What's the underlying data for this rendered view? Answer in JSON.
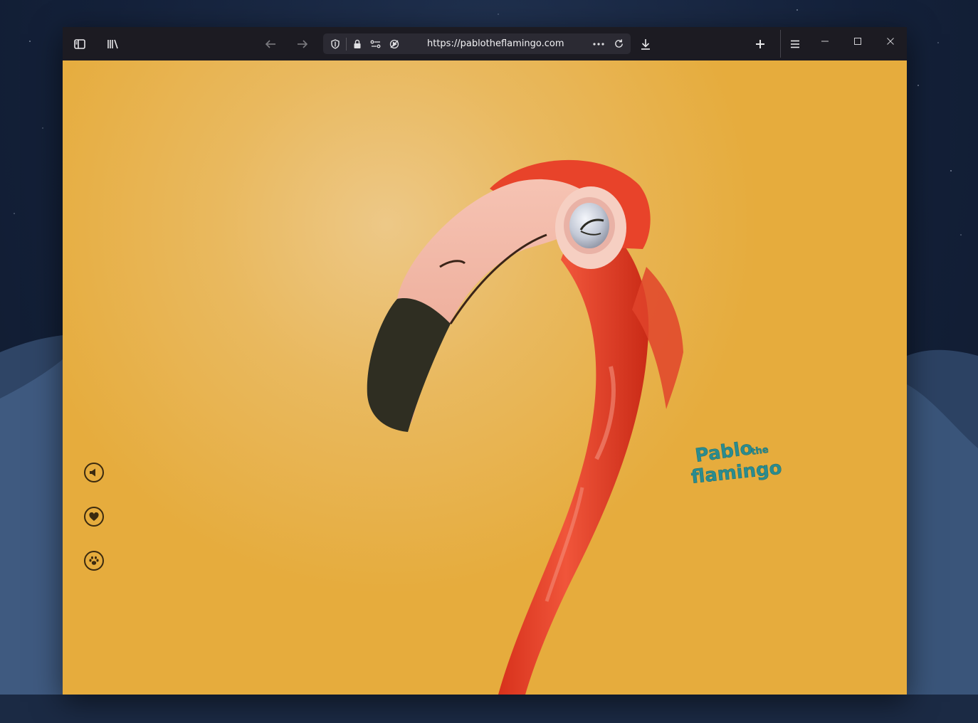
{
  "browser": {
    "url": "https://pablotheflamingo.com",
    "toolbar_icons": [
      "sidebar-icon",
      "library-icon",
      "back-arrow-icon",
      "forward-arrow-icon",
      "shield-icon",
      "lock-icon",
      "permissions-icon",
      "autoplay-blocked-icon",
      "more-dots-icon",
      "reload-icon",
      "download-icon",
      "new-tab-plus-icon",
      "hamburger-menu-icon",
      "minimize-icon",
      "maximize-icon",
      "close-icon"
    ]
  },
  "page": {
    "logo_text": "Pablo the flamingo",
    "side_buttons": [
      "speaker-icon",
      "heart-icon",
      "paw-icon"
    ],
    "colors": {
      "background": "#e6ac3d",
      "flamingo": "#e8432a",
      "beak_tip": "#2f2e22",
      "logo": "#2a8c8f"
    }
  }
}
